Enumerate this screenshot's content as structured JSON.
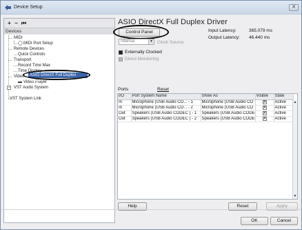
{
  "window": {
    "title": "Device Setup"
  },
  "left": {
    "header": "Devices",
    "toolbar": {
      "add": "+",
      "remove": "−",
      "reset": "⏮"
    },
    "tree": [
      {
        "label": "MIDI"
      },
      {
        "label": "MIDI Port Setup"
      },
      {
        "label": "Remote Devices"
      },
      {
        "label": "Quick Controls"
      },
      {
        "label": "Transport"
      },
      {
        "label": "Record Time Max"
      },
      {
        "label": "Time Display"
      },
      {
        "label": "Video"
      },
      {
        "label": "Video Player"
      },
      {
        "label": "VST Audio System"
      },
      {
        "label": "ASIO DirectX Full Duplex Driver"
      },
      {
        "label": "VST System Link"
      }
    ]
  },
  "right": {
    "driver_title": "ASIO DirectX Full Duplex Driver",
    "control_panel": "Control Panel",
    "input_latency_label": "Input Latency:",
    "input_latency_value": "365.079 ms",
    "output_latency_label": "Output Latency:",
    "output_latency_value": "46.440 ms",
    "clock_select": "Internal",
    "clock_source": "Clock Source",
    "externally_clocked": "Externally Clocked",
    "direct_monitoring": "Direct Monitoring",
    "ports_label": "Ports",
    "reset_link": "Reset",
    "table": {
      "headers": [
        "I/O",
        "Port System Name",
        "Show As",
        "Visible",
        "State"
      ],
      "rows": [
        {
          "io": "In",
          "name": "Microphone (USB Audio CO... - 1",
          "show": "Microphone (USB Audio CO",
          "visible": "✕",
          "state": "Active"
        },
        {
          "io": "In",
          "name": "Microphone (USB Audio CO... - 2",
          "show": "Microphone (USB Audio CO",
          "visible": "✕",
          "state": "Active"
        },
        {
          "io": "Out",
          "name": "Speakers (USB Audio CODEC ) - 1",
          "show": "Speakers (USB Audio CODEC",
          "visible": "✕",
          "state": "Active"
        },
        {
          "io": "Out",
          "name": "Speakers (USB Audio CODEC ) - 2",
          "show": "Speakers (USB Audio CODEC",
          "visible": "✕",
          "state": "Active"
        }
      ]
    },
    "help": "Help",
    "reset": "Reset",
    "apply": "Apply"
  },
  "footer": {
    "ok": "OK",
    "cancel": "Cancel"
  }
}
